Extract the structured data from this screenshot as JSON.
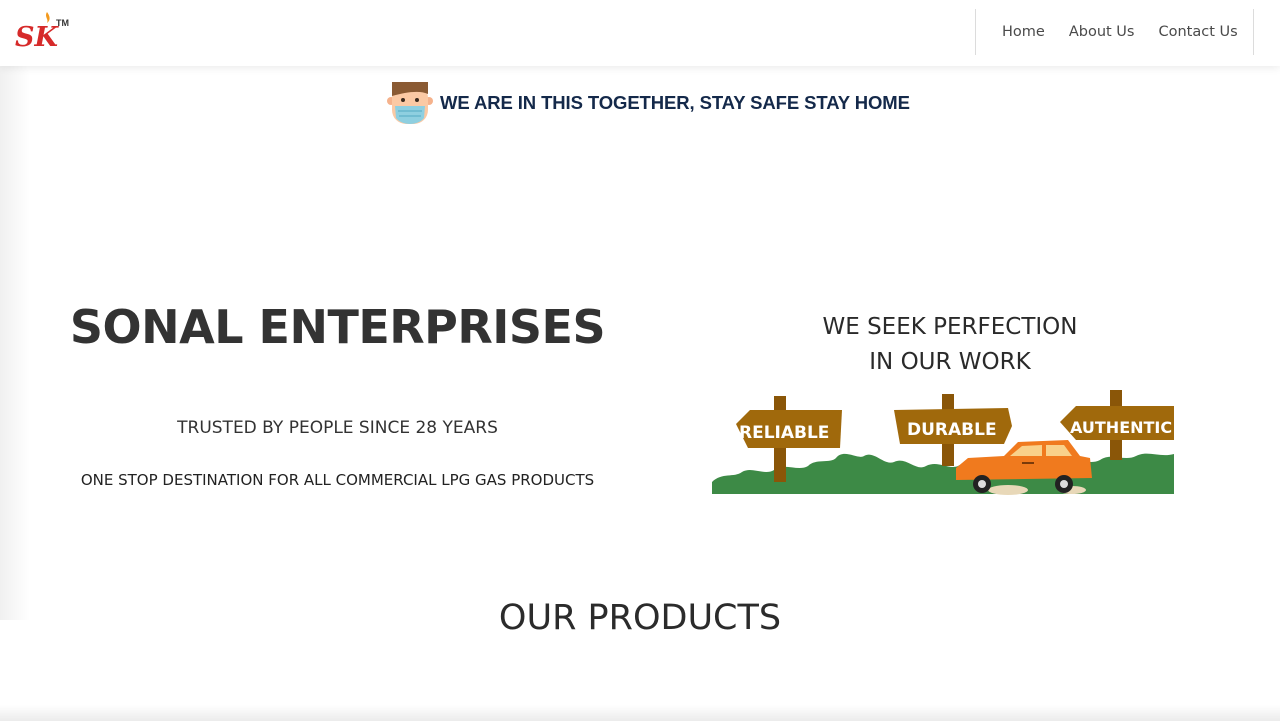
{
  "brand": {
    "logo_text": "SK",
    "logo_mark": "TM",
    "logo_color": "#d62a2a"
  },
  "nav": {
    "items": [
      {
        "label": "Home"
      },
      {
        "label": "About Us"
      },
      {
        "label": "Contact Us"
      }
    ]
  },
  "banner": {
    "icon": "masked-face-icon",
    "text": "WE ARE IN THIS TOGETHER, STAY SAFE STAY HOME",
    "text_color": "#14294a"
  },
  "hero": {
    "title": "SONAL ENTERPRISES",
    "subtitle": "TRUSTED BY PEOPLE SINCE 28 YEARS",
    "description": "ONE STOP DESTINATION FOR ALL COMMERCIAL LPG GAS PRODUCTS"
  },
  "tagline": {
    "line1": "WE SEEK PERFECTION",
    "line2": "IN OUR WORK"
  },
  "signs": {
    "items": [
      "RELIABLE",
      "DURABLE",
      "AUTHENTIC"
    ],
    "sign_color": "#a0690c",
    "bush_color": "#3d8a46",
    "car_color": "#f07a1e"
  },
  "products": {
    "heading": "OUR PRODUCTS"
  }
}
